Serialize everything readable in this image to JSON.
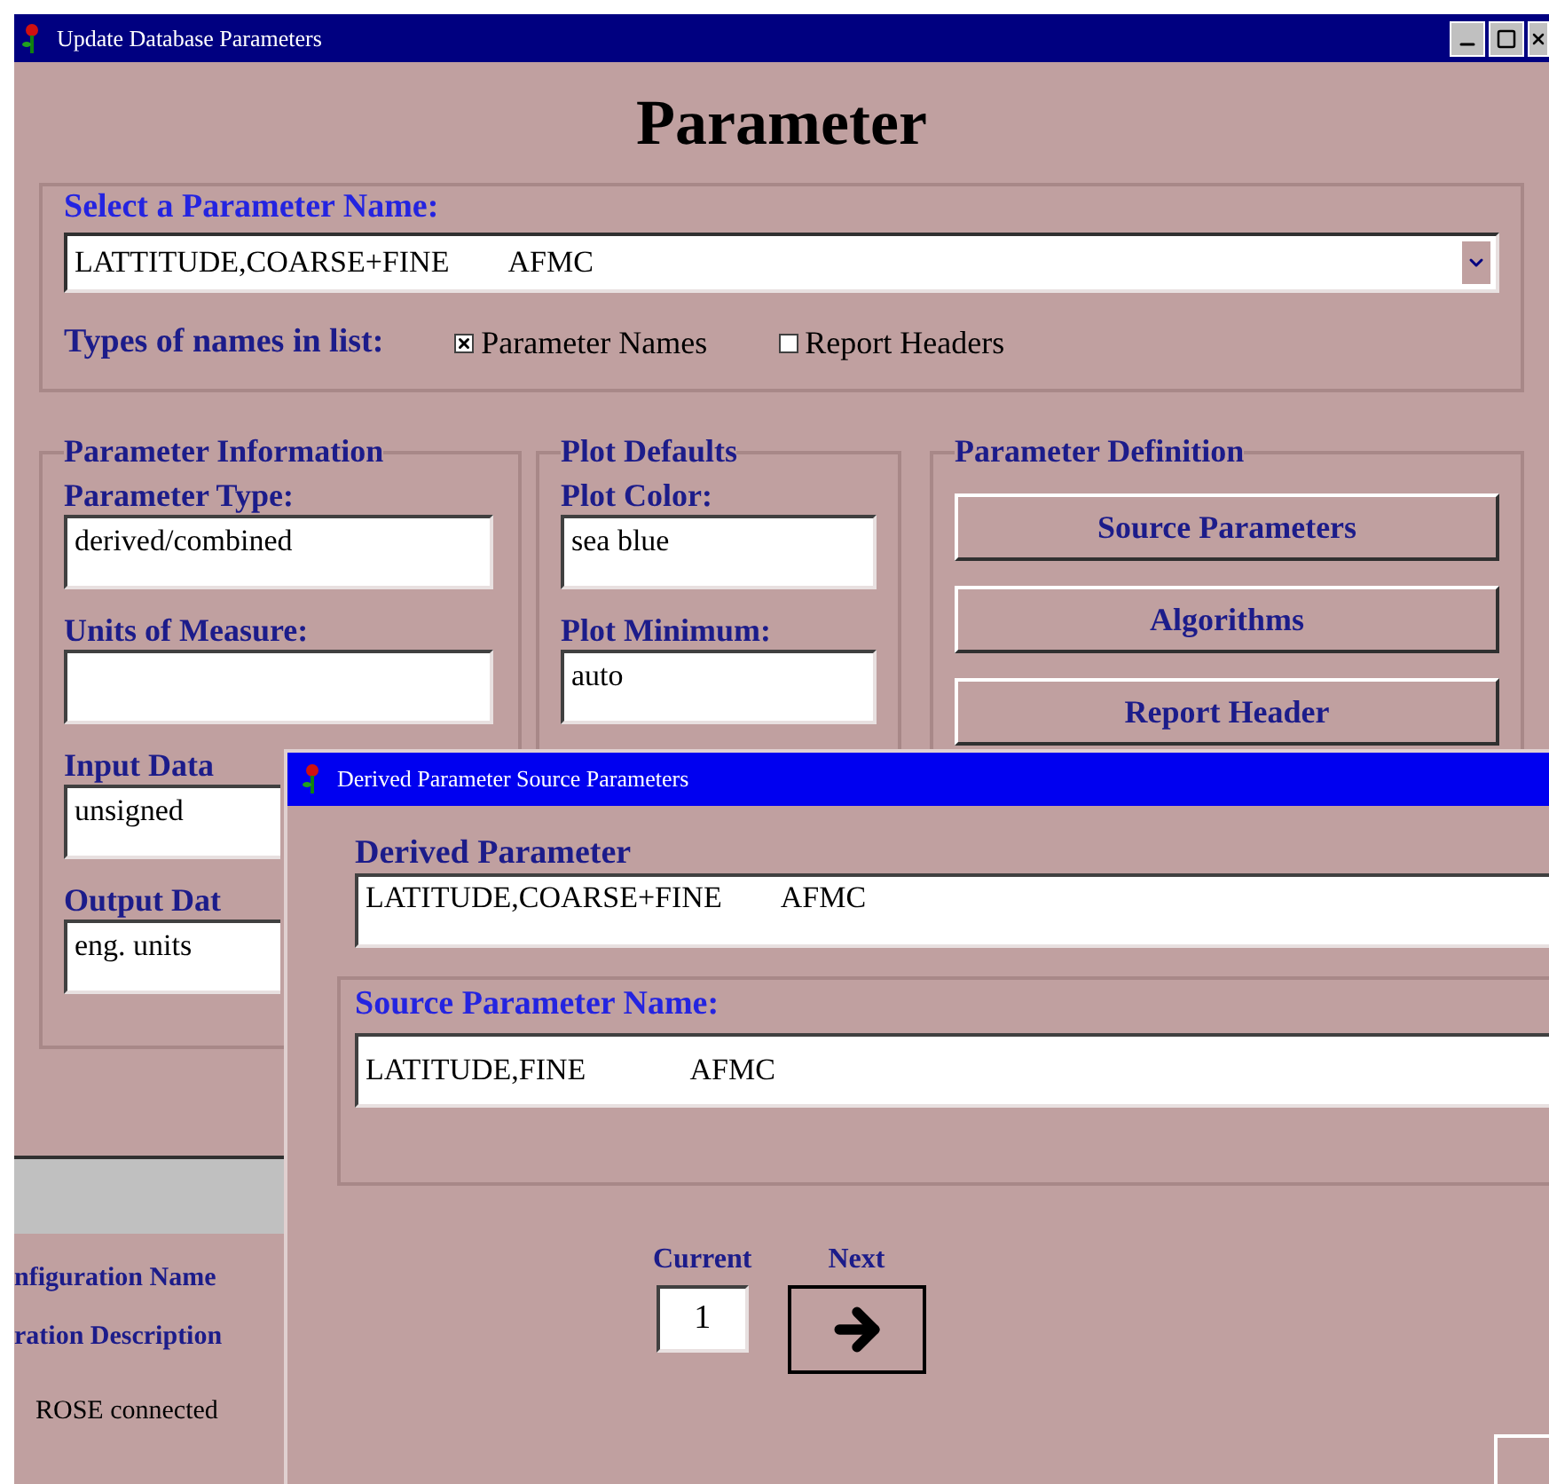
{
  "window": {
    "title": "Update Database Parameters"
  },
  "heading": "Parameter",
  "parameter_select": {
    "label": "Select a Parameter Name:",
    "value": "LATTITUDE,COARSE+FINE        AFMC"
  },
  "name_types": {
    "label": "Types of names in list:",
    "options": [
      {
        "label": "Parameter Names",
        "checked": true
      },
      {
        "label": "Report Headers",
        "checked": false
      }
    ]
  },
  "parameter_information": {
    "title": "Parameter Information",
    "fields": [
      {
        "label": "Parameter Type:",
        "value": "derived/combined"
      },
      {
        "label": "Units of Measure:"
      },
      {
        "label": "Input Data",
        "value": "unsigned"
      },
      {
        "label": "Output Dat",
        "value": "eng. units"
      }
    ]
  },
  "plot_defaults": {
    "title": "Plot Defaults",
    "fields": [
      {
        "label": "Plot Color:",
        "value": "sea blue"
      },
      {
        "label": "Plot Minimum:",
        "value": "auto"
      }
    ]
  },
  "parameter_definition": {
    "title": "Parameter Definition",
    "buttons": [
      "Source Parameters",
      "Algorithms",
      "Report Header"
    ]
  },
  "configuration": {
    "rows": [
      "nfiguration Name",
      "ration Description"
    ]
  },
  "status_bar": {
    "text": "ROSE connected"
  },
  "dialog": {
    "title": "Derived Parameter Source Parameters",
    "derived": {
      "label": "Derived Parameter",
      "value": "LATITUDE,COARSE+FINE        AFMC"
    },
    "source": {
      "label": "Source Parameter Name:",
      "value": "LATITUDE,FINE              AFMC"
    },
    "current": {
      "label": "Current",
      "value": "1"
    },
    "next": {
      "label": "Next"
    }
  }
}
